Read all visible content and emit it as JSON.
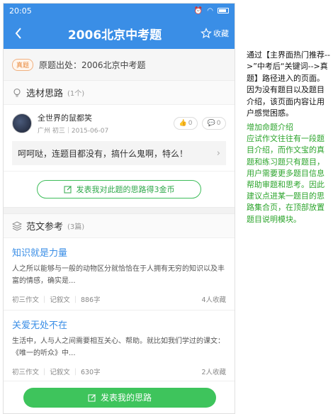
{
  "status": {
    "time": "20:05"
  },
  "nav": {
    "title": "2006北京中考题",
    "fav_label": "收藏"
  },
  "source": {
    "tag": "真题",
    "text": "原题出处：2006北京中考题"
  },
  "ideas": {
    "title": "选材思路",
    "count": "(1个)",
    "item": {
      "name": "全世界的鼠都笑",
      "meta": "广州 初三｜2015-06-07",
      "likes": "0",
      "comments": "0",
      "text": "呵呵哒，连题目都没有，搞什么鬼啊，特么！"
    },
    "publish_label": "发表我对此题的思路得3金币"
  },
  "essays": {
    "title": "范文参考",
    "count": "(3篇)",
    "items": [
      {
        "title": "知识就是力量",
        "excerpt": "人之所以能够与一般的动物区分就恰恰在于人拥有无穷的知识以及丰富的情感，确实是...",
        "grade": "初三作文",
        "type": "记叙文",
        "words": "886字",
        "favs": "4人收藏"
      },
      {
        "title": "关爱无处不在",
        "excerpt": "生活中，人与人之间需要相互关心、帮助。就比如我们学过的课文：《唯一的听众》中...",
        "grade": "初三作文",
        "type": "记叙文",
        "words": "630字",
        "favs": "2人收藏"
      }
    ]
  },
  "bottom": {
    "button": "发表我的思路"
  },
  "notes": {
    "first": "通过【主界面热门推荐-->”中考后“关键词-->真题】路径进入的页面。因为没有题目以及题目介绍，该页面内容让用户感觉困惑。",
    "second": "增加命题介绍\n应试作文往往有一段题目介绍，而作文宝的真题和练习题只有题目，用户需要更多题目信息帮助审题和思考。因此建议点进某一题目的思路集合页，在顶部放置题目说明模块。"
  }
}
